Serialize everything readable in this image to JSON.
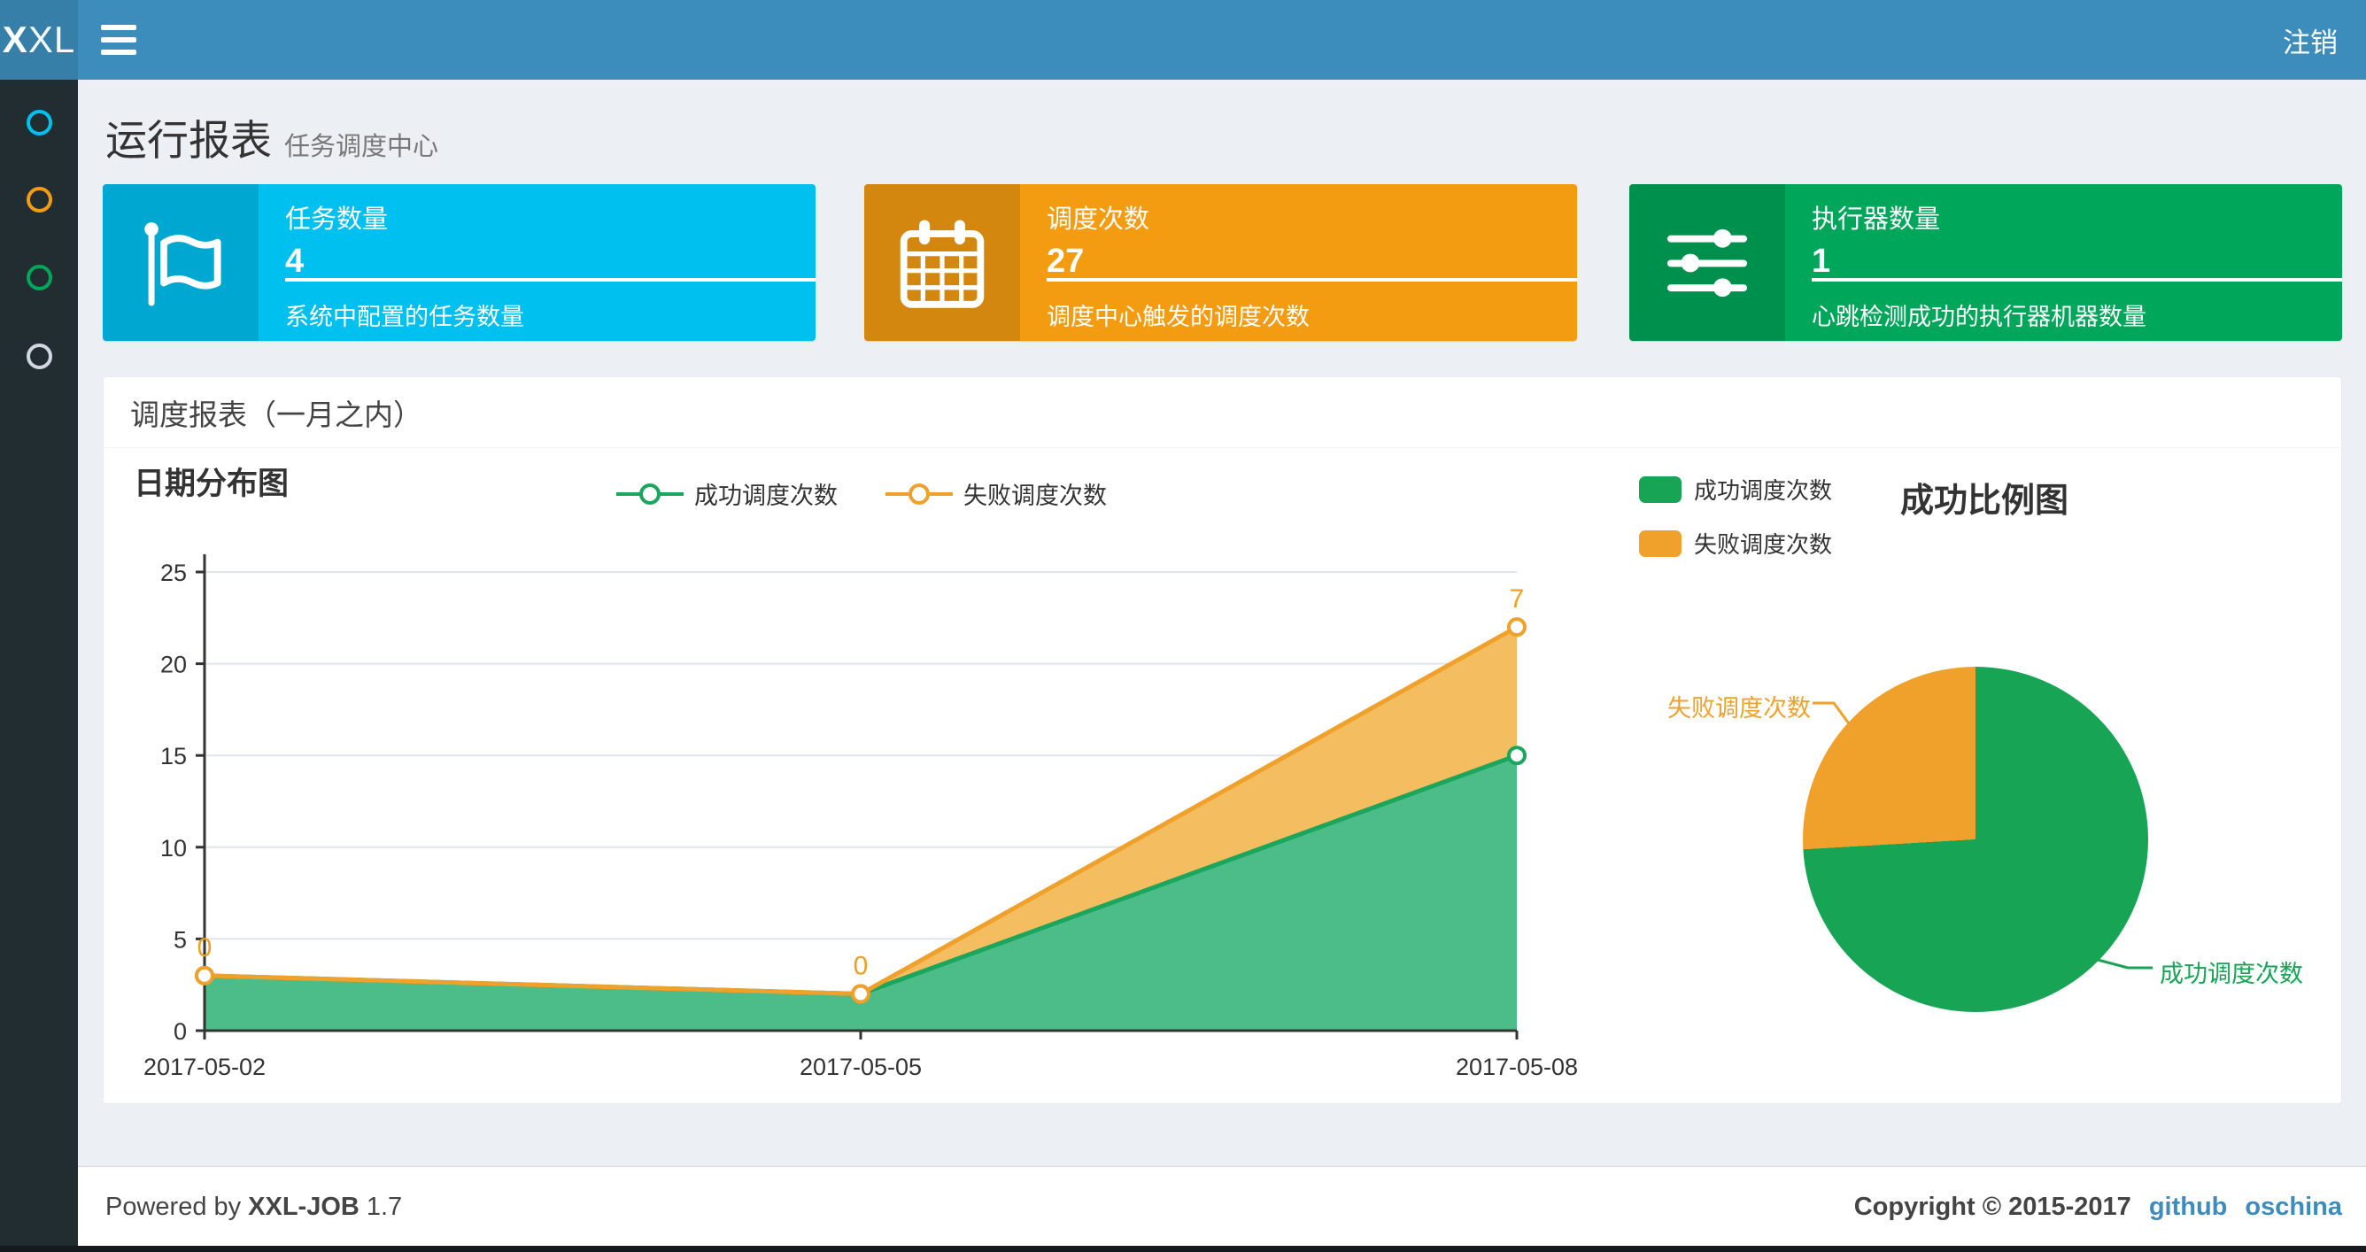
{
  "colors": {
    "navbar": "#3c8dbc",
    "logo_bg": "#367fa9",
    "sidebar_bg": "#222d32",
    "content_bg": "#ecf0f5",
    "link": "#3c8dbc",
    "axis": "#333333",
    "gridline": "#e0e4ec"
  },
  "navbar": {
    "logo_bold": "X",
    "logo_rest": "XL",
    "menu_icon": "hamburger-icon",
    "logout_label": "注销"
  },
  "sidebar": {
    "items": [
      {
        "icon": "circle-icon",
        "color": "#00c0ef"
      },
      {
        "icon": "circle-icon",
        "color": "#f39c12"
      },
      {
        "icon": "circle-icon",
        "color": "#00a65a"
      },
      {
        "icon": "circle-icon",
        "color": "#d2d6de"
      }
    ]
  },
  "header": {
    "title": "运行报表",
    "subtitle": "任务调度中心"
  },
  "stat_cards": [
    {
      "title": "任务数量",
      "value": "4",
      "description": "系统中配置的任务数量",
      "color": "#00c0ef",
      "icon": "flag-icon"
    },
    {
      "title": "调度次数",
      "value": "27",
      "description": "调度中心触发的调度次数",
      "color": "#f39c12",
      "icon": "calendar-icon"
    },
    {
      "title": "执行器数量",
      "value": "1",
      "description": "心跳检测成功的执行器机器数量",
      "color": "#00a65a",
      "icon": "sliders-icon"
    }
  ],
  "panel": {
    "title": "调度报表（一月之内）"
  },
  "chart_data": [
    {
      "type": "area",
      "title": "日期分布图",
      "stacked": true,
      "categories": [
        "2017-05-02",
        "2017-05-05",
        "2017-05-08"
      ],
      "series": [
        {
          "name": "成功调度次数",
          "values": [
            3,
            2,
            15
          ],
          "color": "#1aa65c",
          "fill": "#4cbd88"
        },
        {
          "name": "失败调度次数",
          "values": [
            0,
            0,
            7
          ],
          "color": "#f0a12b",
          "fill": "#f4bd60",
          "show_point_labels": true
        }
      ],
      "point_label_color": "#efa023",
      "ylim": [
        0,
        25
      ],
      "yticks": [
        0,
        5,
        10,
        15,
        20,
        25
      ],
      "grid": true,
      "legend_position": "top-center"
    },
    {
      "type": "pie",
      "title": "成功比例图",
      "slices": [
        {
          "name": "成功调度次数",
          "value": 20,
          "color": "#17a454"
        },
        {
          "name": "失败调度次数",
          "value": 7,
          "color": "#f0a12b"
        }
      ],
      "legend_position": "top-left",
      "start_angle": "top-clockwise"
    }
  ],
  "footer": {
    "powered_prefix": "Powered by",
    "brand": "XXL-JOB",
    "version": "1.7",
    "copyright": "Copyright © 2015-2017",
    "links": [
      {
        "label": "github"
      },
      {
        "label": "oschina"
      }
    ]
  }
}
